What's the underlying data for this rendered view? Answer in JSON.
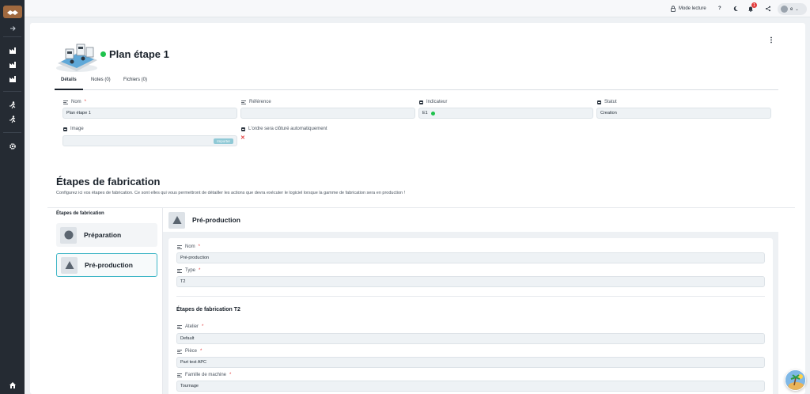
{
  "topbar": {
    "read_mode": "Mode lecture",
    "help": "?",
    "notif_count": "1",
    "user_initial": "e"
  },
  "header": {
    "title": "Plan étape 1",
    "status_color": "#1ec24c"
  },
  "tabs": [
    {
      "label": "Détails",
      "active": true
    },
    {
      "label": "Notes (0)",
      "active": false
    },
    {
      "label": "Fichiers (0)",
      "active": false
    }
  ],
  "form": {
    "nom": {
      "label": "Nom",
      "required": "*",
      "value": "Plan étape 1"
    },
    "reference": {
      "label": "Référence",
      "value": ""
    },
    "indicateur": {
      "label": "Indicateur",
      "value": "E1"
    },
    "statut": {
      "label": "Statut",
      "value": "Creation"
    },
    "image": {
      "label": "Image",
      "button": "Importer"
    },
    "auto_close": {
      "label": "L'ordre sera clôturé automatiquement",
      "value": "✕"
    }
  },
  "steps_section": {
    "title": "Étapes de fabrication",
    "description": "Configurez ici vos étapes de fabrication. Ce sont elles qui vous permettront de détailler les actions que devra exécuter le logiciel lorsque la gamme de fabrication sera en production !",
    "list_title": "Étapes de fabrication",
    "steps": [
      {
        "label": "Préparation",
        "icon": "circle-icon",
        "selected": false
      },
      {
        "label": "Pré-production",
        "icon": "triangle-icon",
        "selected": true
      }
    ]
  },
  "detail": {
    "title": "Pré-production",
    "nom": {
      "label": "Nom",
      "required": "*",
      "value": "Pré-production"
    },
    "type": {
      "label": "Type",
      "required": "*",
      "value": "T2"
    },
    "subtitle": "Étapes de fabrication T2",
    "atelier": {
      "label": "Atelier",
      "required": "*",
      "value": "Default"
    },
    "piece": {
      "label": "Pièce",
      "required": "*",
      "value": "Part test APC"
    },
    "famille": {
      "label": "Famille de machine",
      "required": "*",
      "value": "Tournage"
    }
  },
  "colors": {
    "sidebar": "#252b33",
    "accent": "#3fb6c6",
    "logo": "#a0693f",
    "danger": "#e23d3d"
  }
}
